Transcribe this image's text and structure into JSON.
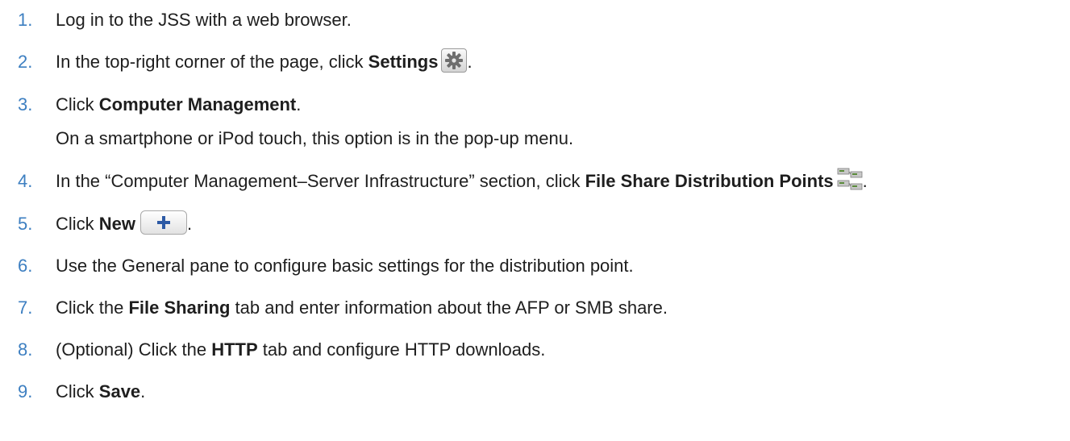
{
  "steps": [
    {
      "num": "1.",
      "before": "Log in to the JSS with a web browser."
    },
    {
      "num": "2.",
      "before": "In the top-right corner of the page, click ",
      "bold": "Settings",
      "after": "."
    },
    {
      "num": "3.",
      "before": "Click ",
      "bold": "Computer Management",
      "after": ".",
      "sub": "On a smartphone or iPod touch, this option is in the pop-up menu."
    },
    {
      "num": "4.",
      "before": "In the “Computer Management–Server Infrastructure” section, click ",
      "bold": "File Share Distribution Points",
      "after": "."
    },
    {
      "num": "5.",
      "before": "Click ",
      "bold": "New",
      "after": "."
    },
    {
      "num": "6.",
      "before": "Use the General pane to configure basic settings for the distribution point."
    },
    {
      "num": "7.",
      "before": "Click the ",
      "bold": "File Sharing",
      "after": " tab and enter information about the AFP or SMB share."
    },
    {
      "num": "8.",
      "before": "(Optional) Click the ",
      "bold": "HTTP",
      "after": " tab and configure HTTP downloads."
    },
    {
      "num": "9.",
      "before": "Click ",
      "bold": "Save",
      "after": "."
    }
  ],
  "icons": {
    "settings": "gear-icon",
    "distribution_points": "server-icon",
    "new": "plus-icon"
  },
  "colors": {
    "step_number": "#3d7fc1",
    "text": "#1e1e1e",
    "plus": "#2d5aa5"
  }
}
